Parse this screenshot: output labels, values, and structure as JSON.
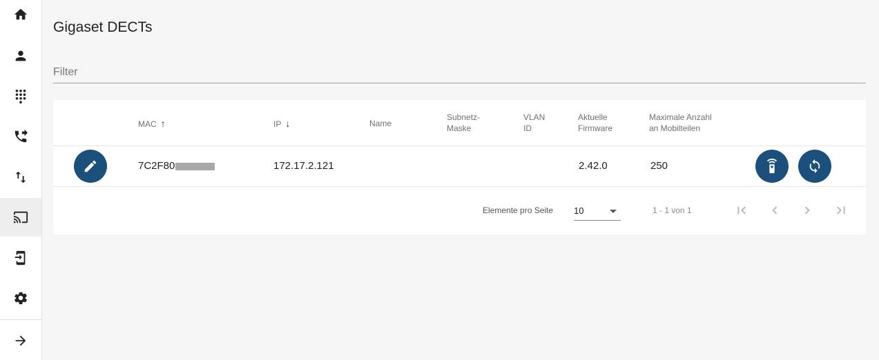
{
  "sidebar": {
    "items": [
      {
        "icon": "home-icon"
      },
      {
        "icon": "person-icon"
      },
      {
        "icon": "dialpad-icon"
      },
      {
        "icon": "call-forward-icon"
      },
      {
        "icon": "swap-vert-icon"
      },
      {
        "icon": "cast-icon",
        "active": true
      },
      {
        "icon": "phone-login-icon"
      },
      {
        "icon": "gear-icon"
      }
    ],
    "expand_icon": "arrow-right-icon"
  },
  "page": {
    "title": "Gigaset DECTs"
  },
  "filter": {
    "placeholder": "Filter",
    "value": ""
  },
  "table": {
    "columns": {
      "mac": "MAC",
      "mac_sort": "↑",
      "ip": "IP",
      "ip_sort": "↓",
      "name": "Name",
      "subnet_line1": "Subnetz-",
      "subnet_line2": "Maske",
      "vlan_line1": "VLAN",
      "vlan_line2": "ID",
      "firmware_line1": "Aktuelle",
      "firmware_line2": "Firmware",
      "max_line1": "Maximale Anzahl",
      "max_line2": "an Mobilteilen"
    },
    "rows": [
      {
        "mac": "7C2F80",
        "ip": "172.17.2.121",
        "name": "",
        "subnet": "",
        "vlan": "",
        "firmware": "2.42.0",
        "max_handsets": "250"
      }
    ],
    "row_actions": [
      "edit-icon",
      "remote-icon",
      "sync-icon"
    ]
  },
  "paginator": {
    "items_per_page_label": "Elemente pro Seite",
    "items_per_page_value": "10",
    "range_label": "1 - 1 von 1"
  },
  "colors": {
    "accent": "#1b4f7c",
    "background": "#f5f5f5"
  }
}
